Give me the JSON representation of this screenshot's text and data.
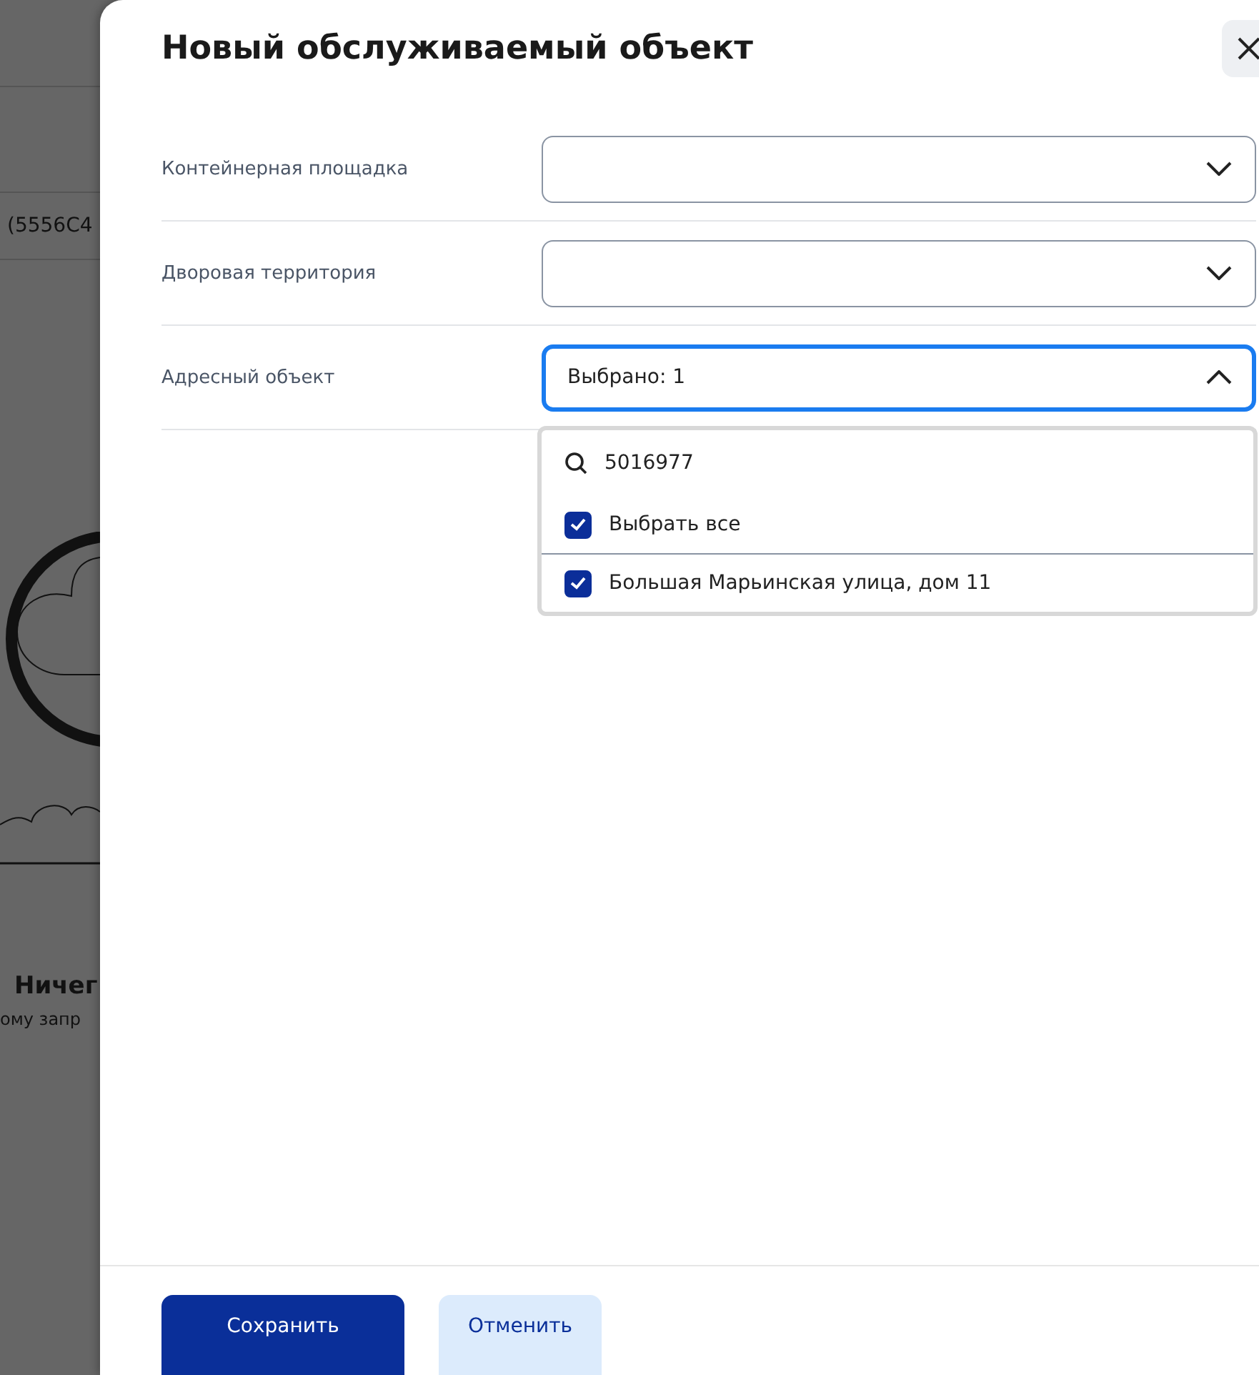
{
  "background": {
    "row_text": "(5556C4",
    "empty_title": "Ничег",
    "empty_text": "ому запр"
  },
  "dialog": {
    "title": "Новый обслуживаемый объект",
    "fields": [
      {
        "label": "Контейнерная площадка",
        "expanded": false
      },
      {
        "label": "Дворовая территория",
        "expanded": false
      },
      {
        "label": "Адресный объект",
        "value": "Выбрано: 1",
        "expanded": true,
        "dropdown": {
          "search_value": "5016977",
          "options": [
            {
              "kind": "select-all",
              "label": "Выбрать все",
              "checked": true
            },
            {
              "kind": "option",
              "label": "Большая Марьинская улица, дом 11",
              "checked": true
            }
          ]
        }
      }
    ],
    "buttons": [
      {
        "kind": "primary",
        "label": "Сохранить"
      },
      {
        "kind": "secondary",
        "label": "Отменить"
      }
    ]
  }
}
